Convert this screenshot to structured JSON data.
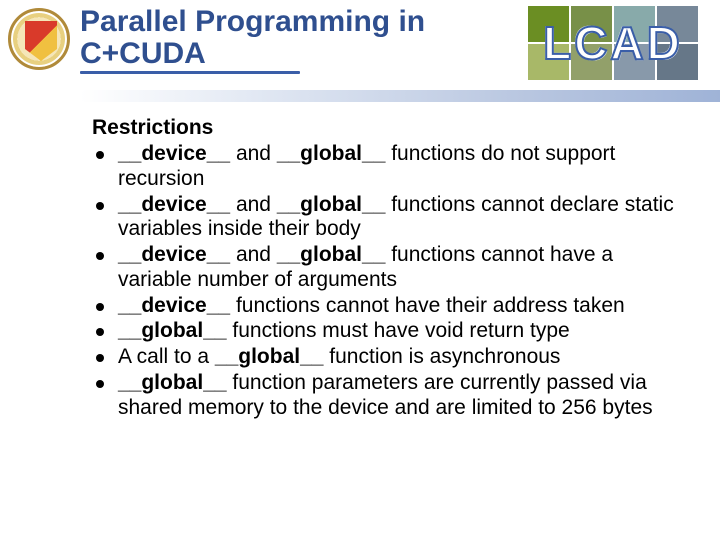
{
  "header": {
    "title_line1": "Parallel Programming in",
    "title_line2": "C+CUDA",
    "logo_text": "LCAD"
  },
  "content": {
    "section_title": "Restrictions",
    "bullets": [
      {
        "parts": [
          {
            "t": "__device__",
            "b": true
          },
          {
            "t": " and ",
            "b": false
          },
          {
            "t": "__global__",
            "b": true
          },
          {
            "t": " functions do not support recursion",
            "b": false
          }
        ]
      },
      {
        "parts": [
          {
            "t": "__device__",
            "b": true
          },
          {
            "t": " and ",
            "b": false
          },
          {
            "t": "__global__",
            "b": true
          },
          {
            "t": " functions cannot declare static variables inside their body",
            "b": false
          }
        ]
      },
      {
        "parts": [
          {
            "t": "__device__",
            "b": true
          },
          {
            "t": " and ",
            "b": false
          },
          {
            "t": "__global__",
            "b": true
          },
          {
            "t": " functions cannot have a variable number of arguments",
            "b": false
          }
        ]
      },
      {
        "parts": [
          {
            "t": "__device__",
            "b": true
          },
          {
            "t": " functions cannot have their address taken",
            "b": false
          }
        ]
      },
      {
        "parts": [
          {
            "t": "__global__",
            "b": true
          },
          {
            "t": " functions must have void return type",
            "b": false
          }
        ]
      },
      {
        "parts": [
          {
            "t": "A call to a ",
            "b": false
          },
          {
            "t": "__global__",
            "b": true
          },
          {
            "t": " function is asynchronous",
            "b": false
          }
        ]
      },
      {
        "parts": [
          {
            "t": "__global__",
            "b": true
          },
          {
            "t": " function parameters are currently passed via shared memory to the device and are limited to 256 bytes",
            "b": false
          }
        ]
      }
    ]
  }
}
